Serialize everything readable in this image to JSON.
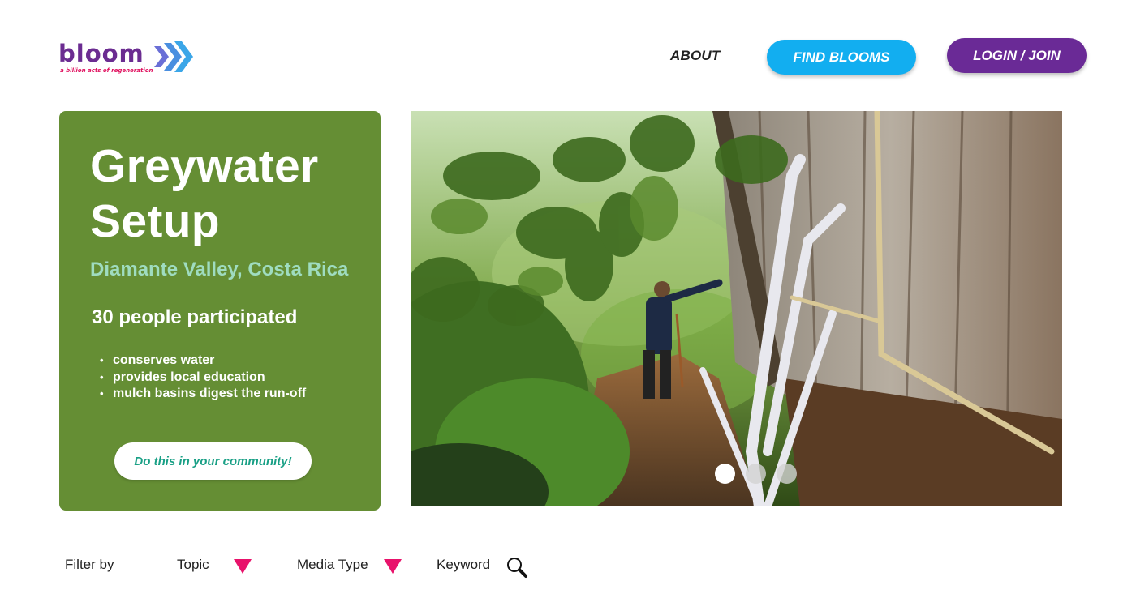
{
  "brand": {
    "name": "bloom",
    "tagline": "a billion acts of regeneration",
    "colors": {
      "purple": "#6b2c91",
      "pink": "#e0115f",
      "blue": "#12aef0"
    }
  },
  "nav": {
    "about_label": "ABOUT",
    "find_label": "FIND BLOOMS",
    "login_label": "LOGIN / JOIN"
  },
  "feature": {
    "title_line1": "Greywater",
    "title_line2": "Setup",
    "location": "Diamante Valley, Costa Rica",
    "participants": "30 people participated",
    "benefits": [
      "conserves water",
      "provides local education",
      "mulch basins digest the run-off"
    ],
    "bullet": "•",
    "cta_label": "Do this in your community!",
    "card_color": "#658e34"
  },
  "carousel": {
    "image_alt": "Person digging a trench beside white greywater pipes along a wooden wall in a jungle garden",
    "slides": 3,
    "active_index": 0
  },
  "filters": {
    "label": "Filter by",
    "topic_label": "Topic",
    "media_type_label": "Media Type",
    "keyword_label": "Keyword",
    "dropdown_color": "#e8126b",
    "icons": {
      "topic": "triangle-down-icon",
      "media_type": "triangle-down-icon",
      "keyword": "search-icon"
    }
  }
}
